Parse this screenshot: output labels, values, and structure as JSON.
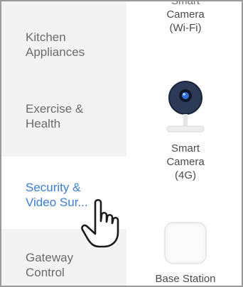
{
  "sidebar": {
    "items": [
      {
        "line1": "Kitchen",
        "line2": "Appliances",
        "active": false
      },
      {
        "line1": "Exercise &",
        "line2": "Health",
        "active": false
      },
      {
        "line1": "Security &",
        "line2": "Video Sur...",
        "active": true
      },
      {
        "line1": "Gateway",
        "line2": "Control",
        "active": false
      }
    ]
  },
  "products": [
    {
      "line1": "Smart",
      "line2": "Camera",
      "line3": "(Wi-Fi)"
    },
    {
      "line1": "Smart",
      "line2": "Camera",
      "line3": "(4G)",
      "icon": "camera-icon"
    },
    {
      "line1": "Base Station",
      "icon": "base-station-icon"
    }
  ],
  "pointer": {
    "icon": "hand-pointer-icon"
  },
  "colors": {
    "active_text": "#3b7dd8",
    "sidebar_bg": "#f3f3f3",
    "text": "#6a6a6a"
  }
}
